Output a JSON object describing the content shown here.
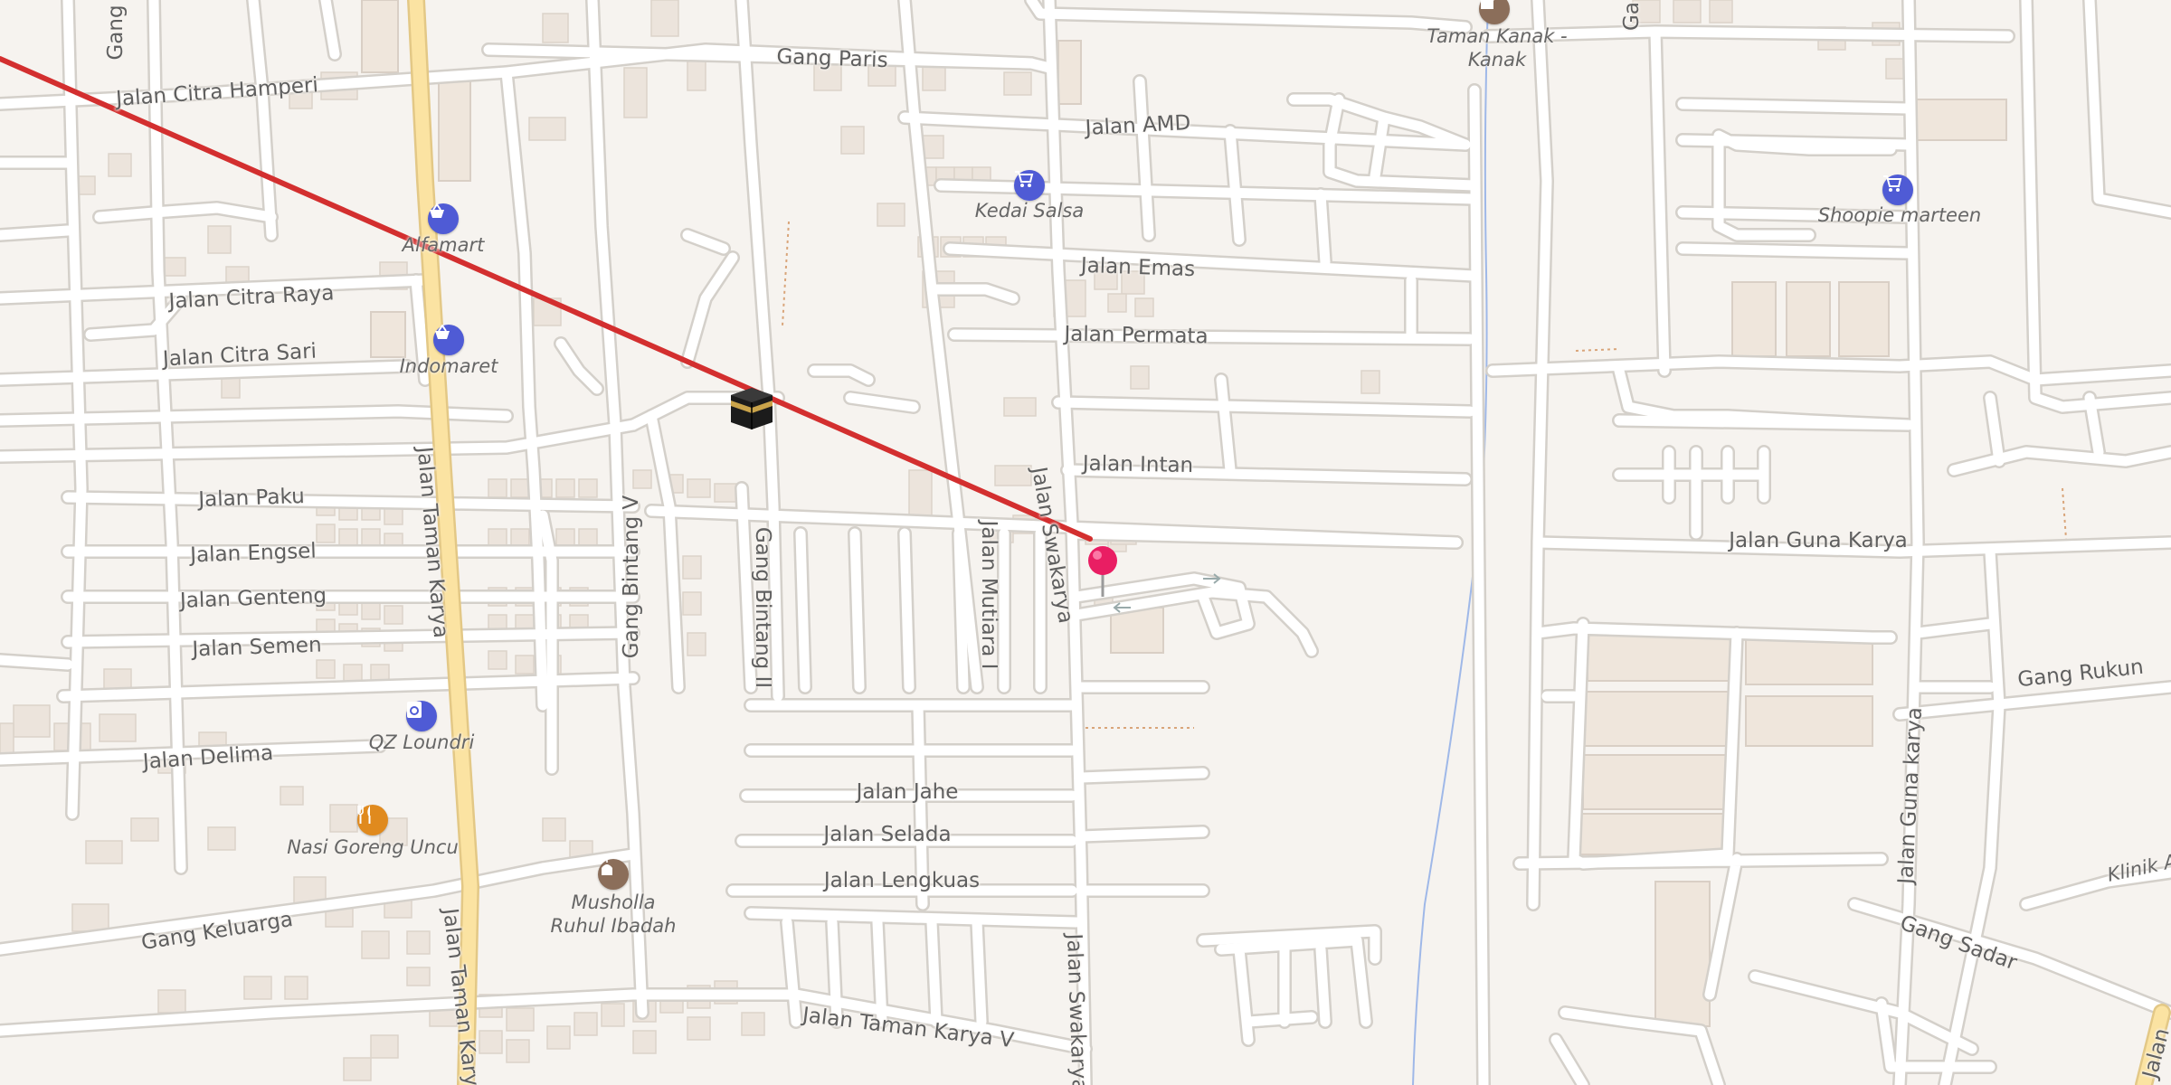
{
  "map": {
    "colors": {
      "background": "#f6f3ef",
      "road": "#ffffff",
      "main_road": "#fbe3a2",
      "qibla_line": "#d32f2f",
      "pin": "#e91e63",
      "poi_blue": "#4f5bd5",
      "poi_food": "#e08a1e",
      "poi_worship": "#8b6e5a",
      "water": "#9fb8e8"
    },
    "qibla_marker": {
      "icon": "kaaba-icon"
    },
    "location_pin": {
      "icon": "map-pin-icon"
    },
    "streets": [
      "Jalan Citra Hamperi",
      "Gang Paris",
      "Jalan AMD",
      "Jalan Emas",
      "Jalan Permata",
      "Jalan Citra Raya",
      "Jalan Citra Sari",
      "Jalan Intan",
      "Jalan Paku",
      "Jalan Engsel",
      "Jalan Genteng",
      "Jalan Semen",
      "Jalan Delima",
      "Gang Keluarga",
      "Jalan Taman Karya",
      "Jalan Taman Karya",
      "Gang Bintang V",
      "Gang Bintang II",
      "Jalan Mutiara I",
      "Jalan Swakarya",
      "Jalan Swakarya",
      "Jalan Jahe",
      "Jalan Selada",
      "Jalan Lengkuas",
      "Jalan Taman Karya V",
      "Jalan Guna Karya",
      "Gang Rukun",
      "Jalan Guna karya",
      "Gang Sadar",
      "Gang",
      "Ga",
      "Jalan"
    ],
    "pois": [
      {
        "name": "Alfamart",
        "icon": "shopping-basket-icon"
      },
      {
        "name": "Indomaret",
        "icon": "shopping-basket-icon"
      },
      {
        "name": "Kedai Salsa",
        "icon": "shopping-cart-icon"
      },
      {
        "name": "Shoopie marteen",
        "icon": "shopping-cart-icon"
      },
      {
        "name": "QZ Loundri",
        "icon": "laundry-icon"
      },
      {
        "name": "Nasi Goreng Uncu",
        "icon": "restaurant-icon"
      },
      {
        "name": "Musholla Ruhul Ibadah",
        "icon": "mosque-icon"
      },
      {
        "name": "Taman Kanak - Kanak",
        "icon": "school-icon"
      },
      {
        "name": "Klinik A",
        "icon": ""
      }
    ]
  }
}
